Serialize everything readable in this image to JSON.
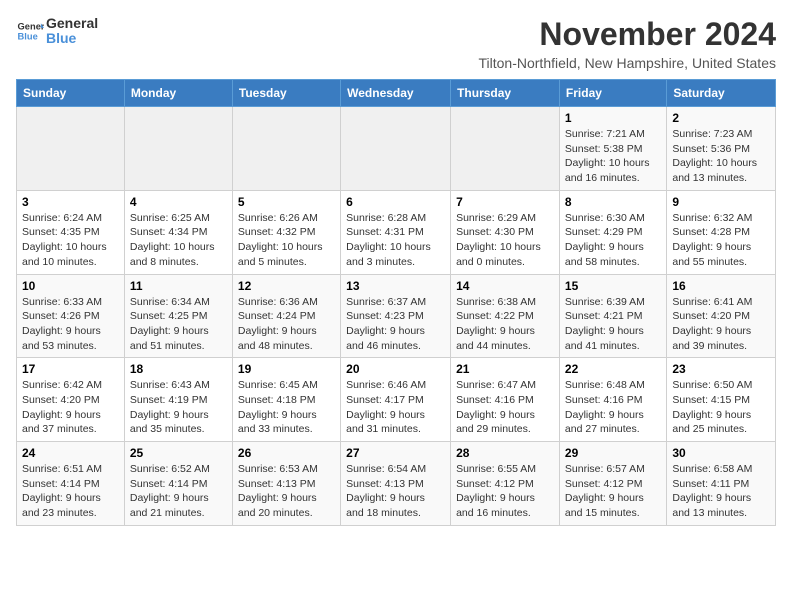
{
  "logo": {
    "line1": "General",
    "line2": "Blue"
  },
  "title": "November 2024",
  "location": "Tilton-Northfield, New Hampshire, United States",
  "weekdays": [
    "Sunday",
    "Monday",
    "Tuesday",
    "Wednesday",
    "Thursday",
    "Friday",
    "Saturday"
  ],
  "weeks": [
    [
      {
        "day": "",
        "info": ""
      },
      {
        "day": "",
        "info": ""
      },
      {
        "day": "",
        "info": ""
      },
      {
        "day": "",
        "info": ""
      },
      {
        "day": "",
        "info": ""
      },
      {
        "day": "1",
        "info": "Sunrise: 7:21 AM\nSunset: 5:38 PM\nDaylight: 10 hours and 16 minutes."
      },
      {
        "day": "2",
        "info": "Sunrise: 7:23 AM\nSunset: 5:36 PM\nDaylight: 10 hours and 13 minutes."
      }
    ],
    [
      {
        "day": "3",
        "info": "Sunrise: 6:24 AM\nSunset: 4:35 PM\nDaylight: 10 hours and 10 minutes."
      },
      {
        "day": "4",
        "info": "Sunrise: 6:25 AM\nSunset: 4:34 PM\nDaylight: 10 hours and 8 minutes."
      },
      {
        "day": "5",
        "info": "Sunrise: 6:26 AM\nSunset: 4:32 PM\nDaylight: 10 hours and 5 minutes."
      },
      {
        "day": "6",
        "info": "Sunrise: 6:28 AM\nSunset: 4:31 PM\nDaylight: 10 hours and 3 minutes."
      },
      {
        "day": "7",
        "info": "Sunrise: 6:29 AM\nSunset: 4:30 PM\nDaylight: 10 hours and 0 minutes."
      },
      {
        "day": "8",
        "info": "Sunrise: 6:30 AM\nSunset: 4:29 PM\nDaylight: 9 hours and 58 minutes."
      },
      {
        "day": "9",
        "info": "Sunrise: 6:32 AM\nSunset: 4:28 PM\nDaylight: 9 hours and 55 minutes."
      }
    ],
    [
      {
        "day": "10",
        "info": "Sunrise: 6:33 AM\nSunset: 4:26 PM\nDaylight: 9 hours and 53 minutes."
      },
      {
        "day": "11",
        "info": "Sunrise: 6:34 AM\nSunset: 4:25 PM\nDaylight: 9 hours and 51 minutes."
      },
      {
        "day": "12",
        "info": "Sunrise: 6:36 AM\nSunset: 4:24 PM\nDaylight: 9 hours and 48 minutes."
      },
      {
        "day": "13",
        "info": "Sunrise: 6:37 AM\nSunset: 4:23 PM\nDaylight: 9 hours and 46 minutes."
      },
      {
        "day": "14",
        "info": "Sunrise: 6:38 AM\nSunset: 4:22 PM\nDaylight: 9 hours and 44 minutes."
      },
      {
        "day": "15",
        "info": "Sunrise: 6:39 AM\nSunset: 4:21 PM\nDaylight: 9 hours and 41 minutes."
      },
      {
        "day": "16",
        "info": "Sunrise: 6:41 AM\nSunset: 4:20 PM\nDaylight: 9 hours and 39 minutes."
      }
    ],
    [
      {
        "day": "17",
        "info": "Sunrise: 6:42 AM\nSunset: 4:20 PM\nDaylight: 9 hours and 37 minutes."
      },
      {
        "day": "18",
        "info": "Sunrise: 6:43 AM\nSunset: 4:19 PM\nDaylight: 9 hours and 35 minutes."
      },
      {
        "day": "19",
        "info": "Sunrise: 6:45 AM\nSunset: 4:18 PM\nDaylight: 9 hours and 33 minutes."
      },
      {
        "day": "20",
        "info": "Sunrise: 6:46 AM\nSunset: 4:17 PM\nDaylight: 9 hours and 31 minutes."
      },
      {
        "day": "21",
        "info": "Sunrise: 6:47 AM\nSunset: 4:16 PM\nDaylight: 9 hours and 29 minutes."
      },
      {
        "day": "22",
        "info": "Sunrise: 6:48 AM\nSunset: 4:16 PM\nDaylight: 9 hours and 27 minutes."
      },
      {
        "day": "23",
        "info": "Sunrise: 6:50 AM\nSunset: 4:15 PM\nDaylight: 9 hours and 25 minutes."
      }
    ],
    [
      {
        "day": "24",
        "info": "Sunrise: 6:51 AM\nSunset: 4:14 PM\nDaylight: 9 hours and 23 minutes."
      },
      {
        "day": "25",
        "info": "Sunrise: 6:52 AM\nSunset: 4:14 PM\nDaylight: 9 hours and 21 minutes."
      },
      {
        "day": "26",
        "info": "Sunrise: 6:53 AM\nSunset: 4:13 PM\nDaylight: 9 hours and 20 minutes."
      },
      {
        "day": "27",
        "info": "Sunrise: 6:54 AM\nSunset: 4:13 PM\nDaylight: 9 hours and 18 minutes."
      },
      {
        "day": "28",
        "info": "Sunrise: 6:55 AM\nSunset: 4:12 PM\nDaylight: 9 hours and 16 minutes."
      },
      {
        "day": "29",
        "info": "Sunrise: 6:57 AM\nSunset: 4:12 PM\nDaylight: 9 hours and 15 minutes."
      },
      {
        "day": "30",
        "info": "Sunrise: 6:58 AM\nSunset: 4:11 PM\nDaylight: 9 hours and 13 minutes."
      }
    ]
  ]
}
